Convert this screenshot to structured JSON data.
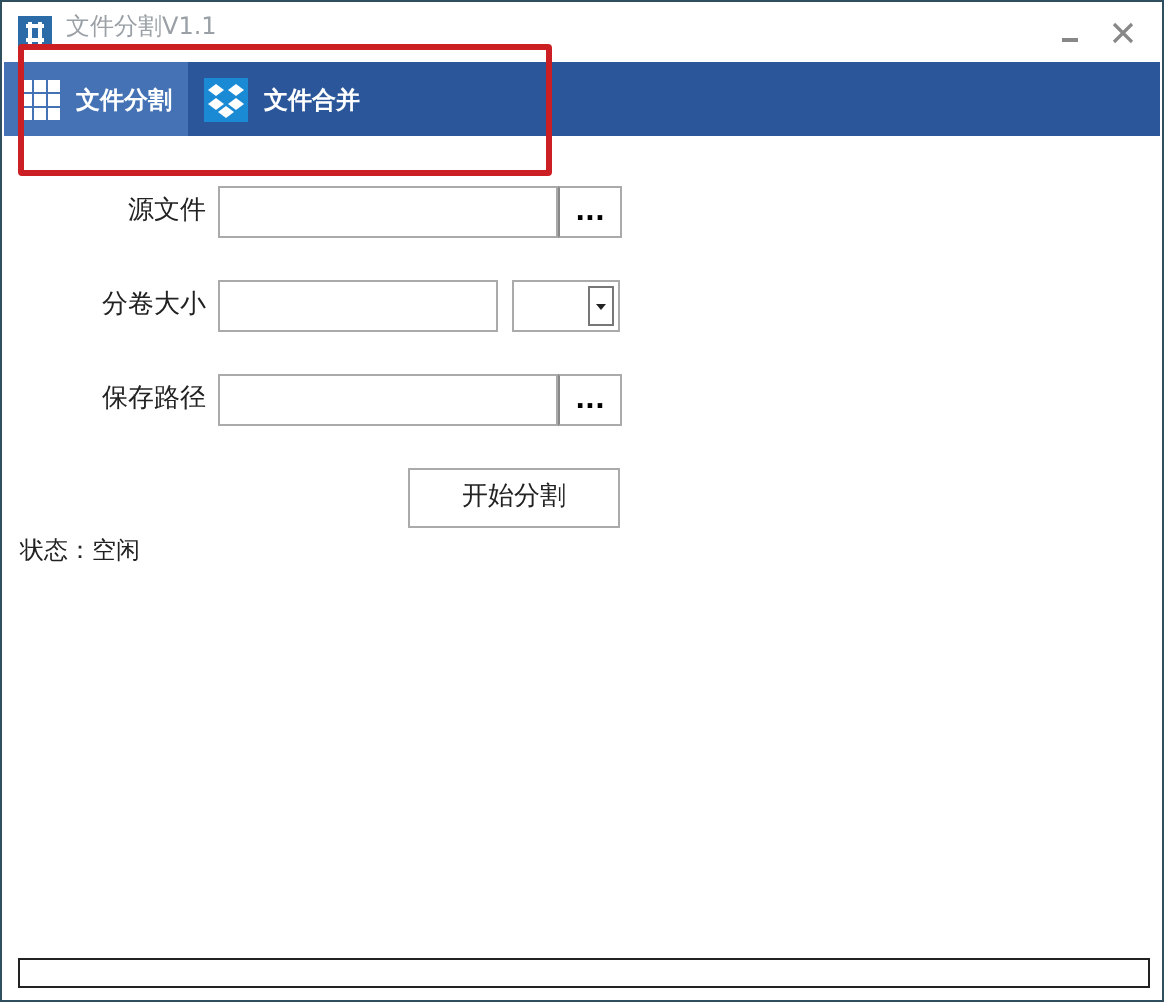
{
  "window": {
    "title": "文件分割V1.1"
  },
  "tabs": [
    {
      "label": "文件分割",
      "kind": "grid",
      "selected": true
    },
    {
      "label": "文件合并",
      "kind": "merge",
      "selected": false
    }
  ],
  "form": {
    "source_file": {
      "label": "源文件",
      "browse": "..."
    },
    "volume_size": {
      "label": "分卷大小"
    },
    "save_path": {
      "label": "保存路径",
      "browse": "..."
    }
  },
  "start_button": "开始分割",
  "status": "状态：空闲",
  "progress": {
    "level": 0
  },
  "highlight": true
}
